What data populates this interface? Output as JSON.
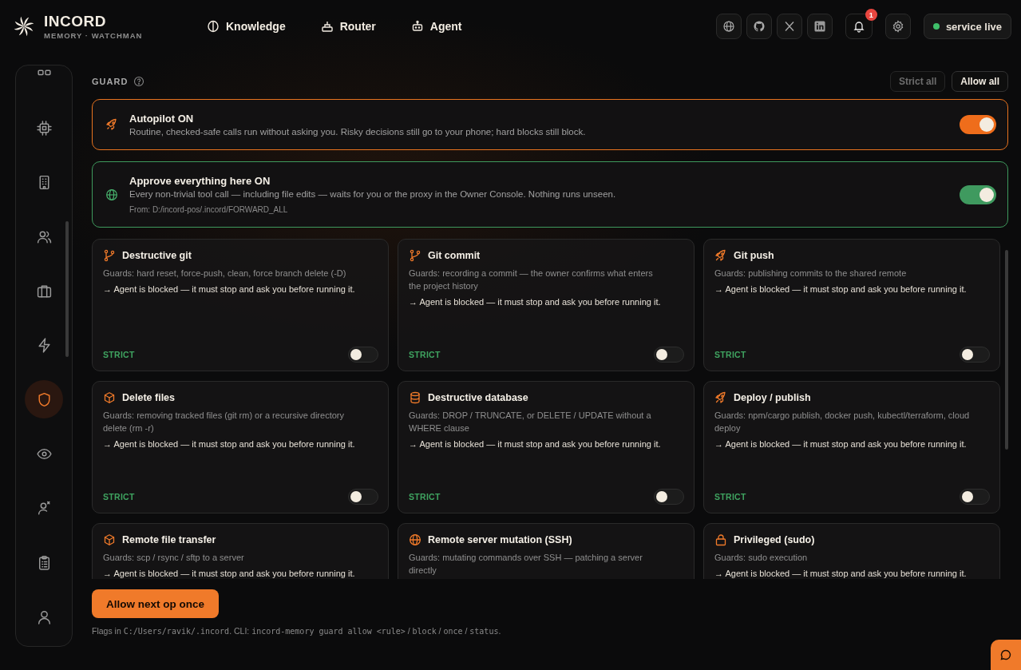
{
  "brand": {
    "name": "INCORD",
    "tagline": "MEMORY · WATCHMAN"
  },
  "nav": [
    {
      "label": "Knowledge"
    },
    {
      "label": "Router"
    },
    {
      "label": "Agent"
    }
  ],
  "notifications": {
    "badge": "1"
  },
  "status": {
    "label": "service live",
    "color": "#3fbf6a"
  },
  "sidebar": {
    "items": [
      {
        "selected": false
      },
      {
        "selected": false
      },
      {
        "selected": false
      },
      {
        "selected": false
      },
      {
        "selected": false
      },
      {
        "selected": false
      },
      {
        "selected": true
      },
      {
        "selected": false
      },
      {
        "selected": false
      },
      {
        "selected": false
      },
      {
        "selected": false
      }
    ]
  },
  "guard": {
    "title": "GUARD",
    "actions": [
      {
        "label": "Strict all",
        "disabled": true
      },
      {
        "label": "Allow all",
        "disabled": false
      }
    ]
  },
  "banners": [
    {
      "kind": "autopilot",
      "title": "Autopilot ON",
      "text": "Routine, checked-safe calls run without asking you. Risky decisions still go to your phone; hard blocks still block.",
      "on": true
    },
    {
      "kind": "approve",
      "title": "Approve everything here ON",
      "text": "Every non-trivial tool call — including file edits — waits for you or the proxy in the Owner Console. Nothing runs unseen.",
      "source": "From: D:/incord-pos/.incord/FORWARD_ALL",
      "on": true
    }
  ],
  "rules": [
    {
      "title": "Destructive git",
      "guards": "Guards: hard reset, force-push, clean, force branch delete (-D)",
      "note": "→ Agent is blocked — it must stop and ask you before running it.",
      "mode": "STRICT",
      "on": false
    },
    {
      "title": "Git commit",
      "guards": "Guards: recording a commit — the owner confirms what enters the project history",
      "note": "→ Agent is blocked — it must stop and ask you before running it.",
      "mode": "STRICT",
      "on": false
    },
    {
      "title": "Git push",
      "guards": "Guards: publishing commits to the shared remote",
      "note": "→ Agent is blocked — it must stop and ask you before running it.",
      "mode": "STRICT",
      "on": false
    },
    {
      "title": "Delete files",
      "guards": "Guards: removing tracked files (git rm) or a recursive directory delete (rm -r)",
      "note": "→ Agent is blocked — it must stop and ask you before running it.",
      "mode": "STRICT",
      "on": false
    },
    {
      "title": "Destructive database",
      "guards": "Guards: DROP / TRUNCATE, or DELETE / UPDATE without a WHERE clause",
      "note": "→ Agent is blocked — it must stop and ask you before running it.",
      "mode": "STRICT",
      "on": false
    },
    {
      "title": "Deploy / publish",
      "guards": "Guards: npm/cargo publish, docker push, kubectl/terraform, cloud deploy",
      "note": "→ Agent is blocked — it must stop and ask you before running it.",
      "mode": "STRICT",
      "on": false
    },
    {
      "title": "Remote file transfer",
      "guards": "Guards: scp / rsync / sftp to a server",
      "note": "→ Agent is blocked — it must stop and ask you before running it."
    },
    {
      "title": "Remote server mutation (SSH)",
      "guards": "Guards: mutating commands over SSH — patching a server directly"
    },
    {
      "title": "Privileged (sudo)",
      "guards": "Guards: sudo execution",
      "note": "→ Agent is blocked — it must stop and ask you before running it."
    }
  ],
  "primary_action": {
    "label": "Allow next op once"
  },
  "footer": [
    {
      "text": "Flags in ",
      "code": false
    },
    {
      "text": "C:/Users/ravik/.incord",
      "code": true
    },
    {
      "text": ". CLI: ",
      "code": false
    },
    {
      "text": "incord-memory guard allow <rule>",
      "code": true
    },
    {
      "text": " / ",
      "code": false
    },
    {
      "text": "block",
      "code": true
    },
    {
      "text": " / ",
      "code": false
    },
    {
      "text": "once",
      "code": true
    },
    {
      "text": " / ",
      "code": false
    },
    {
      "text": "status",
      "code": true
    },
    {
      "text": ".",
      "code": false
    }
  ]
}
